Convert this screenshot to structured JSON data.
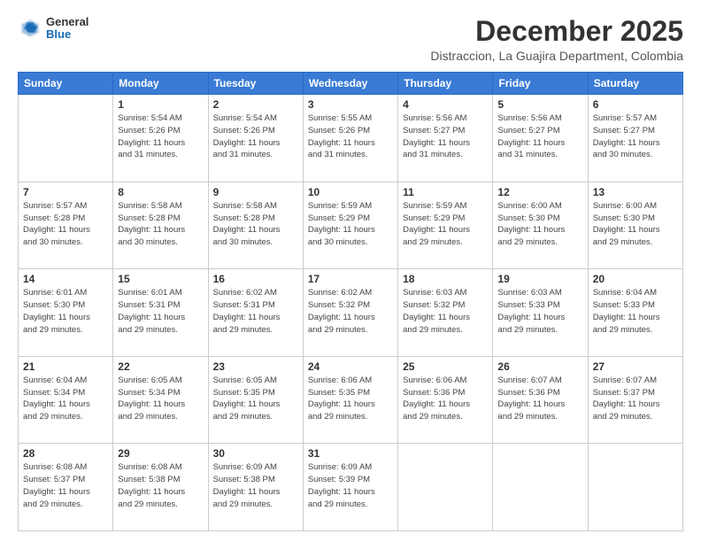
{
  "header": {
    "logo_general": "General",
    "logo_blue": "Blue",
    "month_title": "December 2025",
    "subtitle": "Distraccion, La Guajira Department, Colombia"
  },
  "weekdays": [
    "Sunday",
    "Monday",
    "Tuesday",
    "Wednesday",
    "Thursday",
    "Friday",
    "Saturday"
  ],
  "weeks": [
    [
      {
        "day": "",
        "info": ""
      },
      {
        "day": "1",
        "info": "Sunrise: 5:54 AM\nSunset: 5:26 PM\nDaylight: 11 hours\nand 31 minutes."
      },
      {
        "day": "2",
        "info": "Sunrise: 5:54 AM\nSunset: 5:26 PM\nDaylight: 11 hours\nand 31 minutes."
      },
      {
        "day": "3",
        "info": "Sunrise: 5:55 AM\nSunset: 5:26 PM\nDaylight: 11 hours\nand 31 minutes."
      },
      {
        "day": "4",
        "info": "Sunrise: 5:56 AM\nSunset: 5:27 PM\nDaylight: 11 hours\nand 31 minutes."
      },
      {
        "day": "5",
        "info": "Sunrise: 5:56 AM\nSunset: 5:27 PM\nDaylight: 11 hours\nand 31 minutes."
      },
      {
        "day": "6",
        "info": "Sunrise: 5:57 AM\nSunset: 5:27 PM\nDaylight: 11 hours\nand 30 minutes."
      }
    ],
    [
      {
        "day": "7",
        "info": "Sunrise: 5:57 AM\nSunset: 5:28 PM\nDaylight: 11 hours\nand 30 minutes."
      },
      {
        "day": "8",
        "info": "Sunrise: 5:58 AM\nSunset: 5:28 PM\nDaylight: 11 hours\nand 30 minutes."
      },
      {
        "day": "9",
        "info": "Sunrise: 5:58 AM\nSunset: 5:28 PM\nDaylight: 11 hours\nand 30 minutes."
      },
      {
        "day": "10",
        "info": "Sunrise: 5:59 AM\nSunset: 5:29 PM\nDaylight: 11 hours\nand 30 minutes."
      },
      {
        "day": "11",
        "info": "Sunrise: 5:59 AM\nSunset: 5:29 PM\nDaylight: 11 hours\nand 29 minutes."
      },
      {
        "day": "12",
        "info": "Sunrise: 6:00 AM\nSunset: 5:30 PM\nDaylight: 11 hours\nand 29 minutes."
      },
      {
        "day": "13",
        "info": "Sunrise: 6:00 AM\nSunset: 5:30 PM\nDaylight: 11 hours\nand 29 minutes."
      }
    ],
    [
      {
        "day": "14",
        "info": "Sunrise: 6:01 AM\nSunset: 5:30 PM\nDaylight: 11 hours\nand 29 minutes."
      },
      {
        "day": "15",
        "info": "Sunrise: 6:01 AM\nSunset: 5:31 PM\nDaylight: 11 hours\nand 29 minutes."
      },
      {
        "day": "16",
        "info": "Sunrise: 6:02 AM\nSunset: 5:31 PM\nDaylight: 11 hours\nand 29 minutes."
      },
      {
        "day": "17",
        "info": "Sunrise: 6:02 AM\nSunset: 5:32 PM\nDaylight: 11 hours\nand 29 minutes."
      },
      {
        "day": "18",
        "info": "Sunrise: 6:03 AM\nSunset: 5:32 PM\nDaylight: 11 hours\nand 29 minutes."
      },
      {
        "day": "19",
        "info": "Sunrise: 6:03 AM\nSunset: 5:33 PM\nDaylight: 11 hours\nand 29 minutes."
      },
      {
        "day": "20",
        "info": "Sunrise: 6:04 AM\nSunset: 5:33 PM\nDaylight: 11 hours\nand 29 minutes."
      }
    ],
    [
      {
        "day": "21",
        "info": "Sunrise: 6:04 AM\nSunset: 5:34 PM\nDaylight: 11 hours\nand 29 minutes."
      },
      {
        "day": "22",
        "info": "Sunrise: 6:05 AM\nSunset: 5:34 PM\nDaylight: 11 hours\nand 29 minutes."
      },
      {
        "day": "23",
        "info": "Sunrise: 6:05 AM\nSunset: 5:35 PM\nDaylight: 11 hours\nand 29 minutes."
      },
      {
        "day": "24",
        "info": "Sunrise: 6:06 AM\nSunset: 5:35 PM\nDaylight: 11 hours\nand 29 minutes."
      },
      {
        "day": "25",
        "info": "Sunrise: 6:06 AM\nSunset: 5:36 PM\nDaylight: 11 hours\nand 29 minutes."
      },
      {
        "day": "26",
        "info": "Sunrise: 6:07 AM\nSunset: 5:36 PM\nDaylight: 11 hours\nand 29 minutes."
      },
      {
        "day": "27",
        "info": "Sunrise: 6:07 AM\nSunset: 5:37 PM\nDaylight: 11 hours\nand 29 minutes."
      }
    ],
    [
      {
        "day": "28",
        "info": "Sunrise: 6:08 AM\nSunset: 5:37 PM\nDaylight: 11 hours\nand 29 minutes."
      },
      {
        "day": "29",
        "info": "Sunrise: 6:08 AM\nSunset: 5:38 PM\nDaylight: 11 hours\nand 29 minutes."
      },
      {
        "day": "30",
        "info": "Sunrise: 6:09 AM\nSunset: 5:38 PM\nDaylight: 11 hours\nand 29 minutes."
      },
      {
        "day": "31",
        "info": "Sunrise: 6:09 AM\nSunset: 5:39 PM\nDaylight: 11 hours\nand 29 minutes."
      },
      {
        "day": "",
        "info": ""
      },
      {
        "day": "",
        "info": ""
      },
      {
        "day": "",
        "info": ""
      }
    ]
  ]
}
